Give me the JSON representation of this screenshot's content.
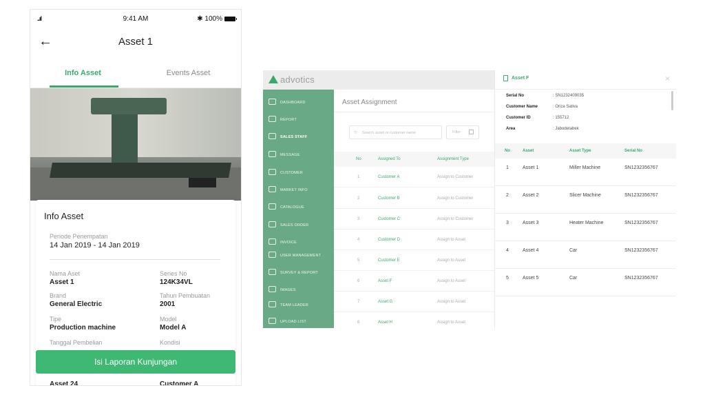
{
  "mobile": {
    "status": {
      "signal": "..ıl",
      "time": "9:41 AM",
      "battery": "✱ 100%"
    },
    "header": {
      "back": "←",
      "title": "Asset 1"
    },
    "tabs": [
      {
        "label": "Info Asset"
      },
      {
        "label": "Events Asset"
      }
    ],
    "card": {
      "title": "Info Asset",
      "placement_label": "Periode Penempatan",
      "placement_value": "14 Jan 2019 - 14 Jan 2019",
      "fields": [
        {
          "label": "Nama Aset",
          "value": "Asset 1"
        },
        {
          "label": "Series No",
          "value": "124K34VL"
        },
        {
          "label": "Brand",
          "value": "General Electric"
        },
        {
          "label": "Tahun Pembuatan",
          "value": "2001"
        },
        {
          "label": "Tipe",
          "value": "Production machine"
        },
        {
          "label": "Model",
          "value": "Model A"
        },
        {
          "label": "Tanggal Pembelian",
          "value": ""
        },
        {
          "label": "Kondisi",
          "value": ""
        },
        {
          "label": "",
          "value": "Asset 24"
        },
        {
          "label": "",
          "value": "Customer A"
        }
      ]
    },
    "cta": "Isi Laporan Kunjungan"
  },
  "desktop": {
    "logo": "advotics",
    "nav": [
      "DASHBOARD",
      "REPORT",
      "SALES STAFF",
      "MESSAGE",
      "CUSTOMER",
      "MARKET INFO",
      "CATALOGUE",
      "SALES ORDER",
      "INVOICE",
      "USER MANAGEMENT",
      "SURVEY & REPORT",
      "IMAGES",
      "TEAM LEADER",
      "UPLOAD LIST"
    ],
    "main": {
      "title": "Asset Assignment",
      "search_placeholder": "Search asset or customer name",
      "filter": "Filter",
      "columns": [
        "No",
        "Assigned To",
        "Assignment Type"
      ],
      "rows": [
        {
          "no": "1",
          "to": "Customer A",
          "type": "Assign to Customer"
        },
        {
          "no": "2",
          "to": "Customer B",
          "type": "Assign to Customer"
        },
        {
          "no": "3",
          "to": "Customer C",
          "type": "Assign to Customer"
        },
        {
          "no": "4",
          "to": "Customer D",
          "type": "Assign to Asset"
        },
        {
          "no": "5",
          "to": "Customer E",
          "type": "Assign to Asset"
        },
        {
          "no": "6",
          "to": "Asset F",
          "type": "Assign to Asset"
        },
        {
          "no": "7",
          "to": "Asset G",
          "type": "Assign to Asset"
        },
        {
          "no": "8",
          "to": "Asset H",
          "type": "Assign to Asset"
        }
      ]
    },
    "panel": {
      "title": "Asset F",
      "close": "×",
      "info": [
        {
          "label": "Serial No",
          "value": ": SN1232409035"
        },
        {
          "label": "Customer Name",
          "value": ": Oriza Sativa"
        },
        {
          "label": "Customer ID",
          "value": ": 155712"
        },
        {
          "label": "Area",
          "value": ": Jabodetabek"
        }
      ],
      "columns": [
        "No",
        "Asset",
        "Asset Type",
        "Serial No"
      ],
      "rows": [
        {
          "no": "1",
          "asset": "Asset 1",
          "type": "Miller Machine",
          "serial": "SN1232356767"
        },
        {
          "no": "2",
          "asset": "Asset 2",
          "type": "Slicer Machine",
          "serial": "SN1232356767"
        },
        {
          "no": "3",
          "asset": "Asset 3",
          "type": "Heater Machine",
          "serial": "SN1232356767"
        },
        {
          "no": "4",
          "asset": "Asset 4",
          "type": "Car",
          "serial": "SN1232356767"
        },
        {
          "no": "5",
          "asset": "Asset 5",
          "type": "Car",
          "serial": "SN1232356767"
        }
      ]
    }
  }
}
